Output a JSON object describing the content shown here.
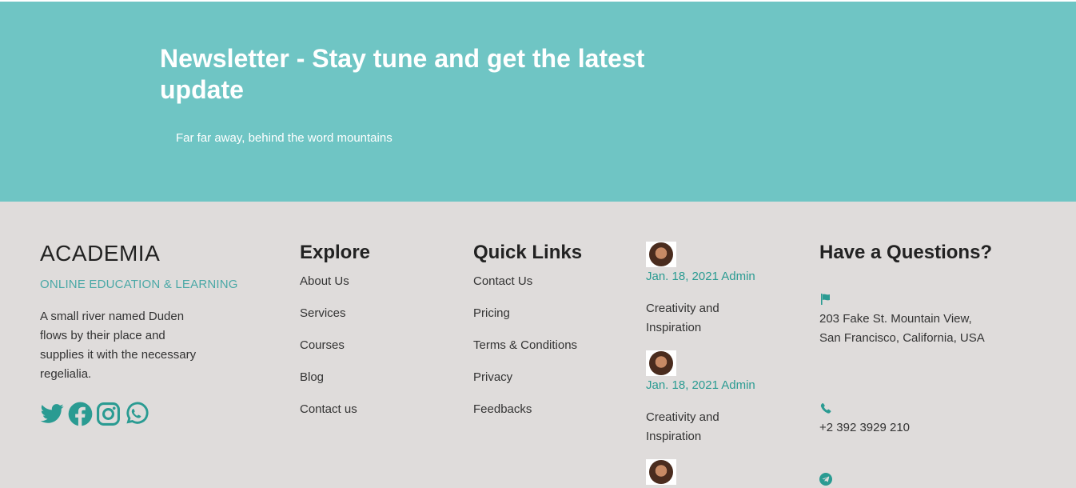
{
  "newsletter": {
    "title": "Newsletter - Stay tune and get the latest update",
    "subtitle": "Far far away, behind the word mountains"
  },
  "brand": {
    "name": "ACADEMIA",
    "tagline": "ONLINE EDUCATION & LEARNING",
    "description": "A small river named Duden flows by their place and supplies it with the necessary regelialia.",
    "social": [
      "twitter-icon",
      "facebook-icon",
      "instagram-icon",
      "whatsapp-icon"
    ]
  },
  "explore": {
    "title": "Explore",
    "links": [
      "About Us",
      "Services",
      "Courses",
      "Blog",
      "Contact us"
    ]
  },
  "quick_links": {
    "title": "Quick Links",
    "links": [
      "Contact Us",
      "Pricing",
      "Terms & Conditions",
      "Privacy",
      "Feedbacks"
    ]
  },
  "posts": [
    {
      "meta": "Jan. 18, 2021 Admin",
      "title": "Creativity and Inspiration"
    },
    {
      "meta": "Jan. 18, 2021 Admin",
      "title": "Creativity and Inspiration"
    }
  ],
  "contact": {
    "title": "Have a Questions?",
    "address": "203 Fake St. Mountain View, San Francisco, California, USA",
    "phone": "+2 392 3929 210"
  },
  "colors": {
    "newsletter_bg": "#6fc5c4",
    "footer_bg": "#dfdcdb",
    "accent": "#2a9b92"
  }
}
